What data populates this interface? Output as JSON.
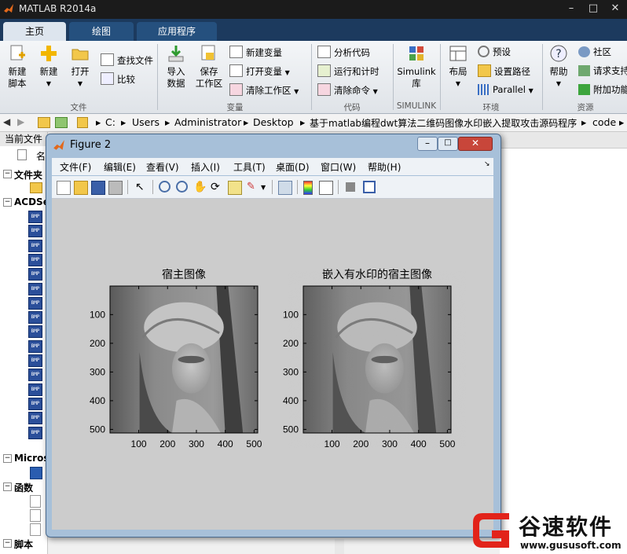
{
  "app": {
    "title": "MATLAB R2014a"
  },
  "tabs": [
    {
      "label": "主页"
    },
    {
      "label": "绘图"
    },
    {
      "label": "应用程序"
    }
  ],
  "ribbon": {
    "new_script": "新建\n脚本",
    "new": "新建",
    "open": "打开",
    "find_files": "查找文件",
    "compare": "比较",
    "import_data": "导入\n数据",
    "save_workspace": "保存\n工作区",
    "new_variable": "新建变量",
    "open_variable": "打开变量",
    "clear_workspace": "清除工作区",
    "analyze_code": "分析代码",
    "run_and_time": "运行和计时",
    "clear_commands": "清除命令",
    "simulink_library": "Simulink\n库",
    "layout": "布局",
    "preferences": "预设",
    "set_path": "设置路径",
    "parallel": "Parallel",
    "help": "帮助",
    "community": "社区",
    "request_support": "请求支持",
    "add_ons": "附加功能",
    "groups": {
      "file": "文件",
      "variable": "变量",
      "code": "代码",
      "simulink": "SIMULINK",
      "environment": "环境",
      "resources": "资源"
    }
  },
  "address": {
    "crumbs": [
      "C:",
      "Users",
      "Administrator",
      "Desktop",
      "基于matlab编程dwt算法二维码图像水印嵌入提取攻击源码程序",
      "code"
    ]
  },
  "leftpanel": {
    "header": "当前文件",
    "col_name": "名",
    "folder_label": "文件夹",
    "acdsee": "ACDSe",
    "bmp_tag": "BMP",
    "microsoft": "Micros",
    "functions": "函数",
    "scripts": "脚本"
  },
  "figure": {
    "title": "Figure 2",
    "menu": [
      "文件(F)",
      "编辑(E)",
      "查看(V)",
      "插入(I)",
      "工具(T)",
      "桌面(D)",
      "窗口(W)",
      "帮助(H)"
    ],
    "axes": [
      {
        "title": "宿主图像",
        "yticks": [
          "100",
          "200",
          "300",
          "400",
          "500"
        ],
        "xticks": [
          "100",
          "200",
          "300",
          "400",
          "500"
        ]
      },
      {
        "title": "嵌入有水印的宿主图像",
        "yticks": [
          "100",
          "200",
          "300",
          "400",
          "500"
        ],
        "xticks": [
          "100",
          "200",
          "300",
          "400",
          "500"
        ]
      }
    ]
  },
  "watermark": {
    "name": "谷速软件",
    "url": "www.gususoft.com",
    "color": "#e2231a"
  }
}
